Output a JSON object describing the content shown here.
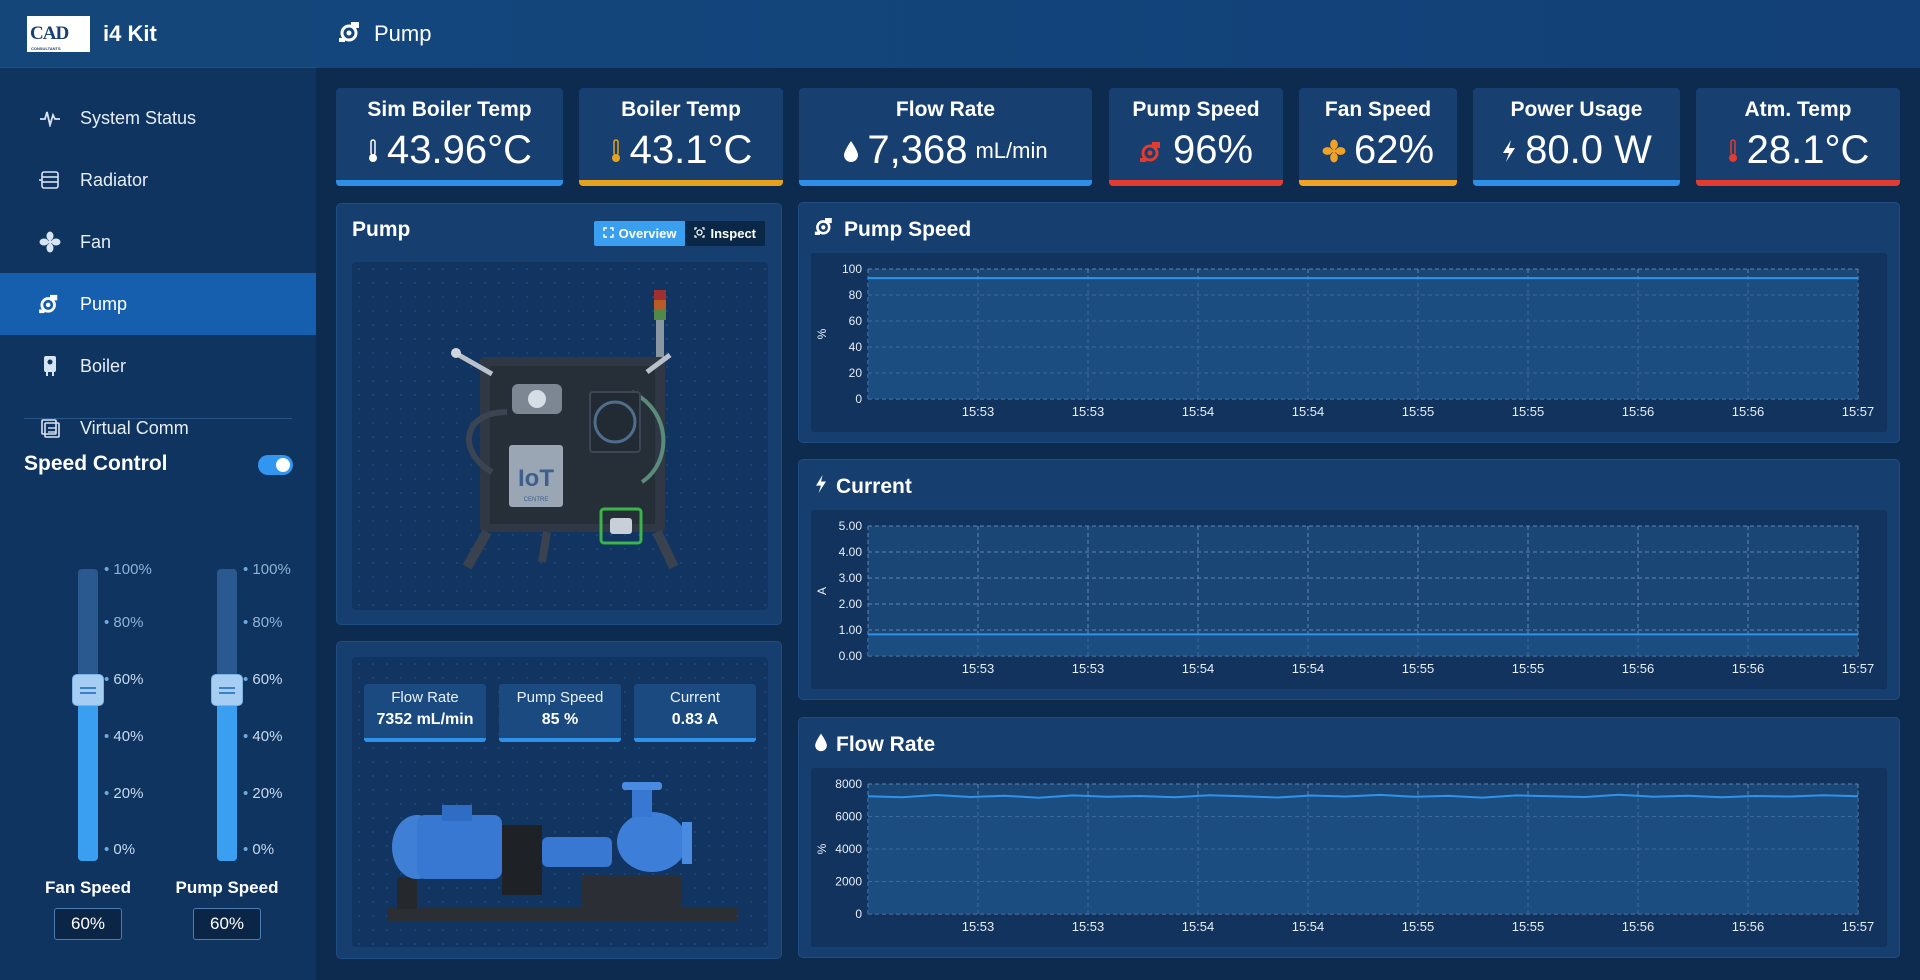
{
  "brand": {
    "logo_text": "CAD",
    "logo_subtext": "CONSULTANTS",
    "app_name": "i4 Kit"
  },
  "header": {
    "title": "Pump"
  },
  "sidebar": {
    "items": [
      {
        "label": "System Status",
        "icon": "pulse-icon",
        "active": false
      },
      {
        "label": "Radiator",
        "icon": "radiator-icon",
        "active": false
      },
      {
        "label": "Fan",
        "icon": "fan-icon",
        "active": false
      },
      {
        "label": "Pump",
        "icon": "pump-icon",
        "active": true
      },
      {
        "label": "Boiler",
        "icon": "boiler-icon",
        "active": false
      },
      {
        "label": "Virtual Comm",
        "icon": "virtual-comm-icon",
        "active": false
      }
    ],
    "speed_control": {
      "title": "Speed Control",
      "enabled": true,
      "ticks": [
        "100%",
        "80%",
        "60%",
        "40%",
        "20%",
        "0%"
      ],
      "fan": {
        "label": "Fan Speed",
        "value_text": "60%",
        "level": 0.6
      },
      "pump": {
        "label": "Pump Speed",
        "value_text": "60%",
        "level": 0.6
      }
    }
  },
  "kpis": [
    {
      "title": "Sim Boiler Temp",
      "value": "43.96°C",
      "unit": "",
      "icon": "thermometer-icon",
      "color": "#2f8fe6"
    },
    {
      "title": "Boiler Temp",
      "value": "43.1°C",
      "unit": "",
      "icon": "thermometer-icon",
      "color": "#e5a21d"
    },
    {
      "title": "Flow Rate",
      "value": "7,368",
      "unit": "mL/min",
      "icon": "droplet-icon",
      "color": "#2f8fe6"
    },
    {
      "title": "Pump Speed",
      "value": "96%",
      "unit": "",
      "icon": "pump-icon",
      "color": "#e23b30"
    },
    {
      "title": "Fan Speed",
      "value": "62%",
      "unit": "",
      "icon": "fan-icon",
      "color": "#f2a224"
    },
    {
      "title": "Power Usage",
      "value": "80.0 W",
      "unit": "",
      "icon": "bolt-icon",
      "color": "#2f8fe6"
    },
    {
      "title": "Atm. Temp",
      "value": "28.1°C",
      "unit": "",
      "icon": "thermometer-icon",
      "color": "#e23b30"
    }
  ],
  "pump_panel": {
    "title": "Pump",
    "buttons": {
      "overview": "Overview",
      "inspect": "Inspect"
    },
    "model_logo": "IoT",
    "model_logo_sub": "CENTRE"
  },
  "pump_metrics": [
    {
      "title": "Flow Rate",
      "value": "7352 mL/min"
    },
    {
      "title": "Pump Speed",
      "value": "85 %"
    },
    {
      "title": "Current",
      "value": "0.83 A"
    }
  ],
  "chart_data": [
    {
      "type": "line",
      "title": "Pump Speed",
      "ylabel": "%",
      "ylim": [
        0,
        100
      ],
      "yticks": [
        "0",
        "20",
        "40",
        "60",
        "80",
        "100"
      ],
      "xticks": [
        "15:53",
        "15:53",
        "15:54",
        "15:54",
        "15:55",
        "15:55",
        "15:56",
        "15:56",
        "15:57"
      ],
      "series": [
        {
          "values": [
            93,
            93,
            93,
            93,
            93,
            93,
            93,
            93,
            93,
            93
          ]
        }
      ],
      "grid": true,
      "color": "#2f93ea"
    },
    {
      "type": "line",
      "title": "Current",
      "ylabel": "A",
      "ylim": [
        0,
        5
      ],
      "yticks": [
        "0.00",
        "1.00",
        "2.00",
        "3.00",
        "4.00",
        "5.00"
      ],
      "xticks": [
        "15:53",
        "15:53",
        "15:54",
        "15:54",
        "15:55",
        "15:55",
        "15:56",
        "15:56",
        "15:57"
      ],
      "series": [
        {
          "values": [
            0.83,
            0.83,
            0.83,
            0.83,
            0.83,
            0.83,
            0.83,
            0.83,
            0.83,
            0.83
          ]
        }
      ],
      "grid": true,
      "color": "#2f93ea"
    },
    {
      "type": "line",
      "title": "Flow Rate",
      "ylabel": "%",
      "ylim": [
        0,
        8000
      ],
      "yticks": [
        "0",
        "2000",
        "4000",
        "6000",
        "8000"
      ],
      "xticks": [
        "15:53",
        "15:53",
        "15:54",
        "15:54",
        "15:55",
        "15:55",
        "15:56",
        "15:56",
        "15:57"
      ],
      "series": [
        {
          "values": [
            7250,
            7180,
            7320,
            7200,
            7280,
            7150,
            7300,
            7220,
            7260,
            7190,
            7310,
            7240,
            7170,
            7290,
            7230,
            7330,
            7210,
            7270,
            7160,
            7300,
            7250,
            7200,
            7340,
            7220,
            7280,
            7190,
            7260,
            7230,
            7310,
            7250
          ]
        }
      ],
      "grid": true,
      "color": "#2f93ea"
    }
  ]
}
